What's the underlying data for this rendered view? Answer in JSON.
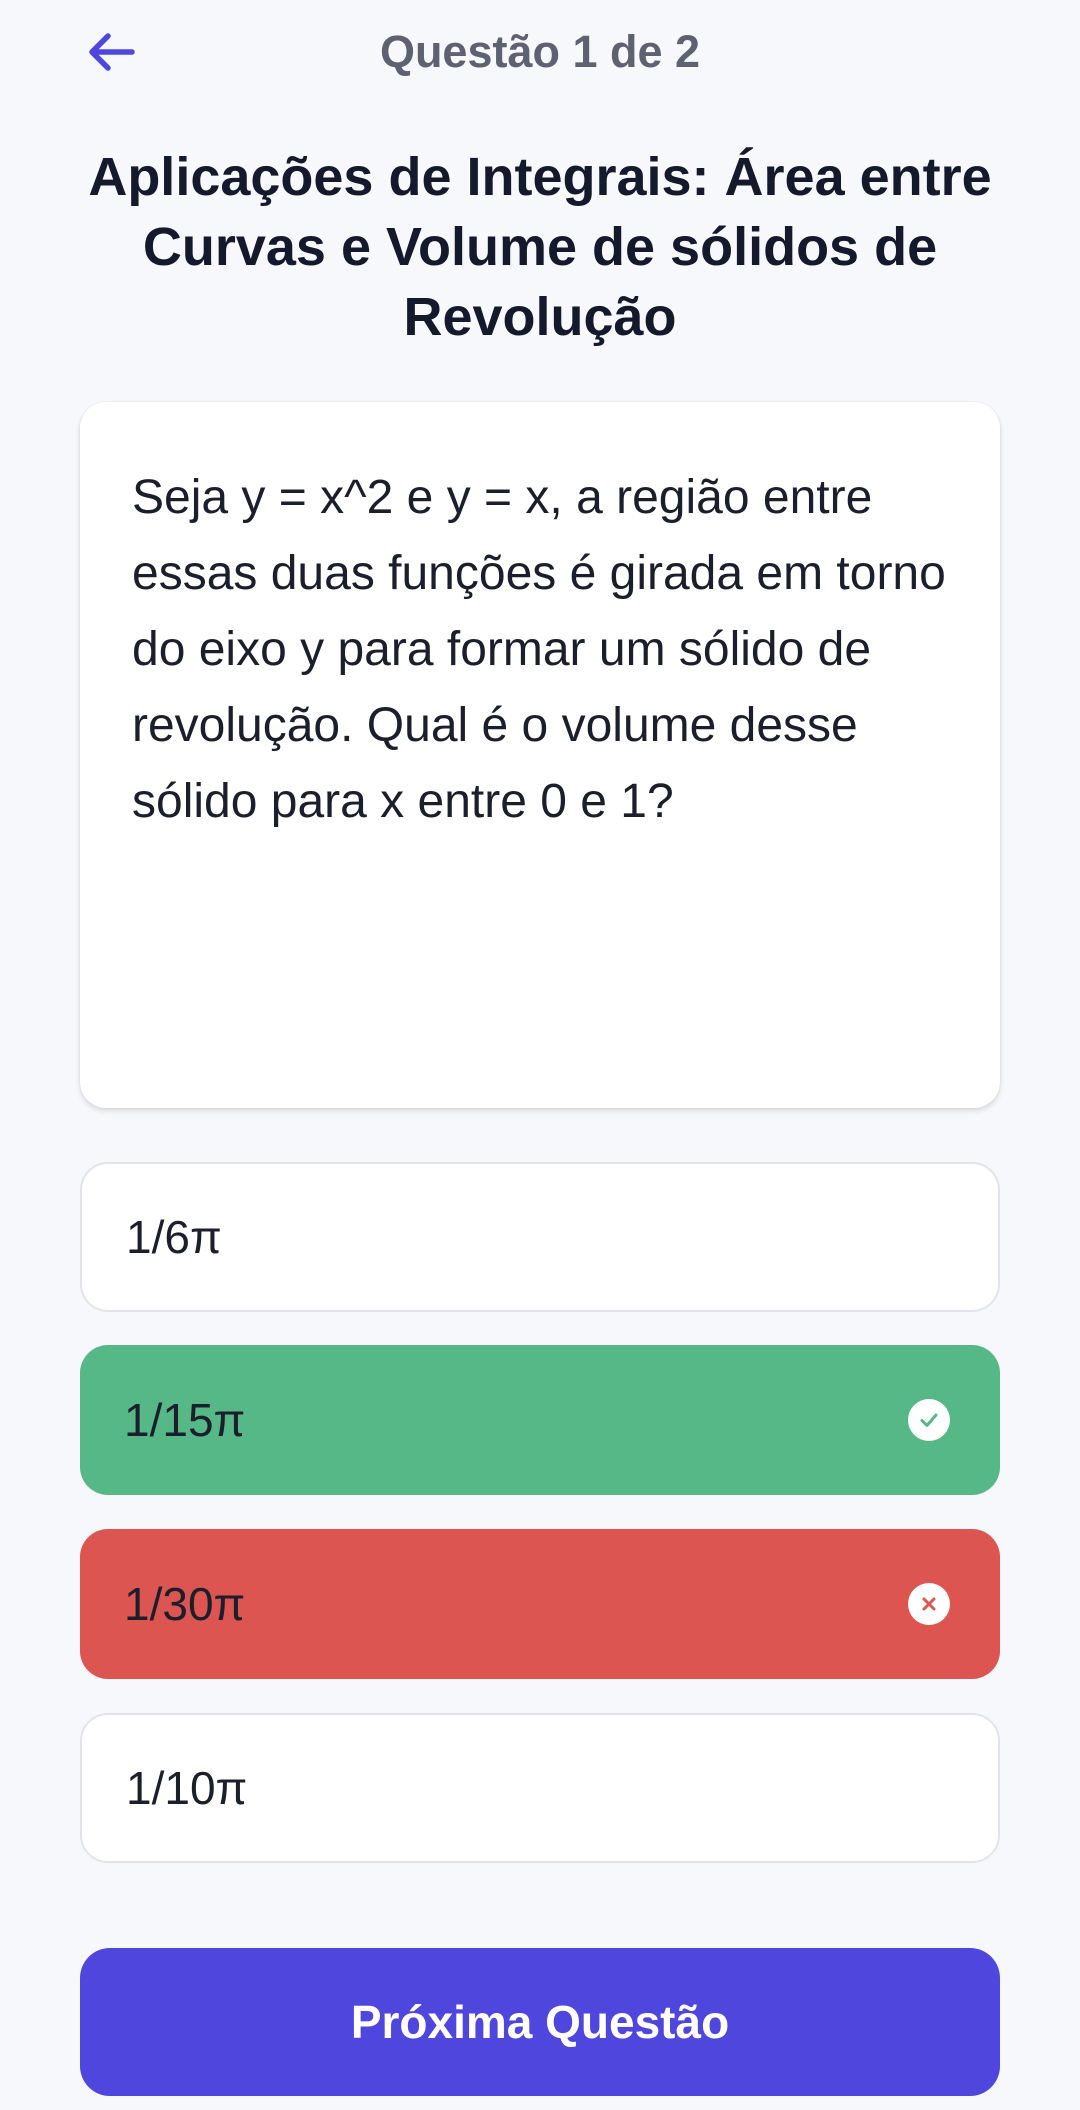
{
  "header": {
    "back_icon": "arrow-left-icon",
    "progress": "Questão 1 de 2"
  },
  "title": "Aplicações de Integrais: Área entre Curvas e Volume de sólidos de Revolução",
  "question": {
    "text": "Seja y = x^2 e y = x, a região entre essas duas funções é girada em torno do eixo y para formar um sólido de revolução. Qual é o volume desse sólido para x entre 0 e 1?"
  },
  "options": [
    {
      "label": "1/6π",
      "state": "neutral"
    },
    {
      "label": "1/15π",
      "state": "correct",
      "icon": "check-icon"
    },
    {
      "label": "1/30π",
      "state": "wrong",
      "icon": "close-icon"
    },
    {
      "label": "1/10π",
      "state": "neutral"
    }
  ],
  "next_button": {
    "label": "Próxima Questão"
  },
  "colors": {
    "accent": "#4f46dd",
    "correct": "#57b887",
    "wrong": "#dd5550",
    "background": "#f7f8fb"
  }
}
